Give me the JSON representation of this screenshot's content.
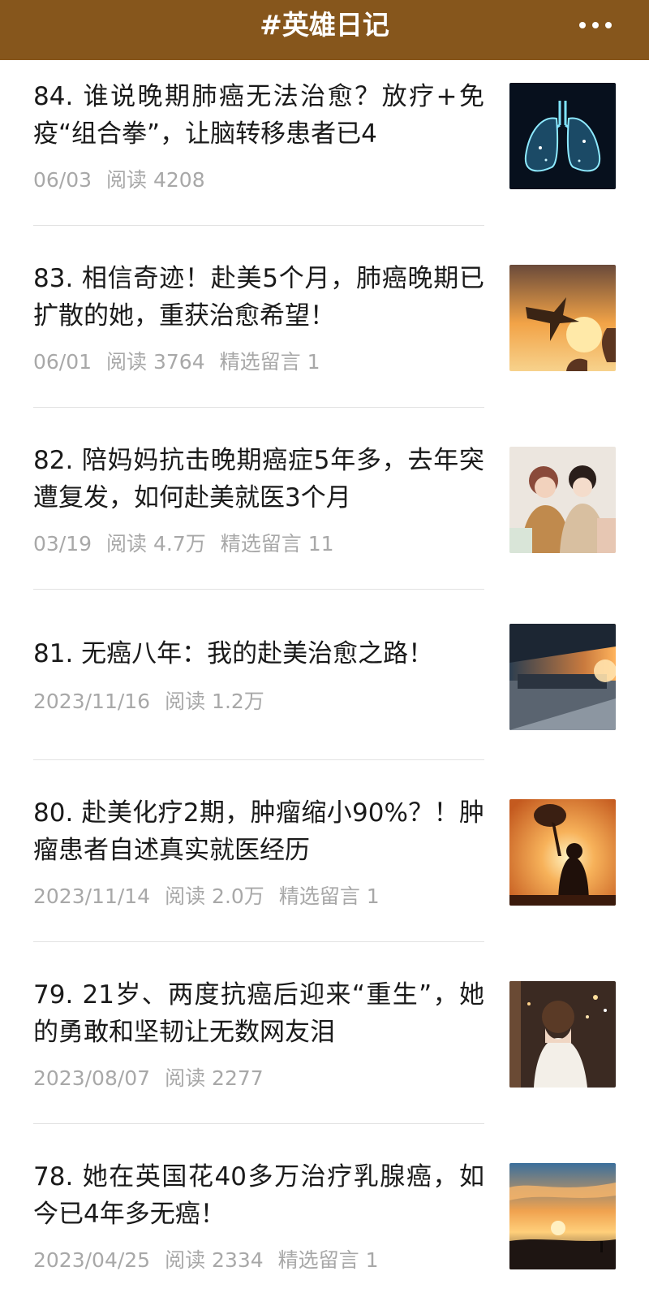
{
  "header": {
    "title": "#英雄日记",
    "more_icon": "more-dots-icon"
  },
  "articles": [
    {
      "title": "84. 谁说晚期肺癌无法治愈？放疗+免疫“组合拳”，让脑转移患者已4",
      "date": "06/03",
      "reads": "阅读 4208",
      "comments": "",
      "thumb": "lungs-image"
    },
    {
      "title": "83. 相信奇迹！赴美5个月，肺癌晚期已扩散的她，重获治愈希望！",
      "date": "06/01",
      "reads": "阅读 3764",
      "comments": "精选留言 1",
      "thumb": "bird-sunset-image"
    },
    {
      "title": "82. 陪妈妈抗击晚期癌症5年多，去年突遭复发，如何赴美就医3个月",
      "date": "03/19",
      "reads": "阅读 4.7万",
      "comments": "精选留言 11",
      "thumb": "mother-daughter-image"
    },
    {
      "title": "81. 无癌八年：我的赴美治愈之路！",
      "date": "2023/11/16",
      "reads": "阅读 1.2万",
      "comments": "",
      "thumb": "airport-image"
    },
    {
      "title": "80. 赴美化疗2期，肿瘤缩小90%？！肿瘤患者自述真实就医经历",
      "date": "2023/11/14",
      "reads": "阅读 2.0万",
      "comments": "精选留言 1",
      "thumb": "woman-hat-sunset-image"
    },
    {
      "title": "79. 21岁、两度抗癌后迎来“重生”，她的勇敢和坚韧让无数网友泪",
      "date": "2023/08/07",
      "reads": "阅读 2277",
      "comments": "",
      "thumb": "bride-image"
    },
    {
      "title": "78. 她在英国花40多万治疗乳腺癌，如今已4年多无癌！",
      "date": "2023/04/25",
      "reads": "阅读 2334",
      "comments": "精选留言 1",
      "thumb": "beach-sunset-image"
    }
  ]
}
